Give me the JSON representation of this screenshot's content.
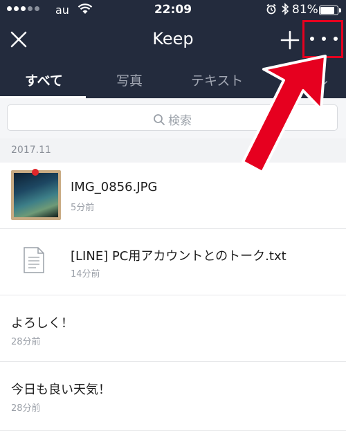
{
  "status_bar": {
    "carrier": "au",
    "time": "22:09",
    "battery_percent": "81%",
    "battery_level": 0.81
  },
  "header": {
    "title": "Keep"
  },
  "tabs": [
    {
      "label": "すべて",
      "active": true
    },
    {
      "label": "写真",
      "active": false
    },
    {
      "label": "テキスト",
      "active": false
    },
    {
      "label": "ル",
      "active": false
    }
  ],
  "search": {
    "placeholder": "検索"
  },
  "section": {
    "date": "2017.11"
  },
  "items": [
    {
      "title": "IMG_0856.JPG",
      "time": "5分前",
      "kind": "image"
    },
    {
      "title": "[LINE] PC用アカウントとのトーク.txt",
      "time": "14分前",
      "kind": "file"
    },
    {
      "title": "よろしく！",
      "time": "28分前",
      "kind": "text"
    },
    {
      "title": "今日も良い天気！",
      "time": "28分前",
      "kind": "text"
    }
  ],
  "icons": {
    "close": "close-icon",
    "add": "plus-icon",
    "more": "more-icon",
    "search": "search-icon",
    "file": "document-icon"
  },
  "colors": {
    "header_bg": "#232b3d",
    "annotation": "#e6001f"
  }
}
